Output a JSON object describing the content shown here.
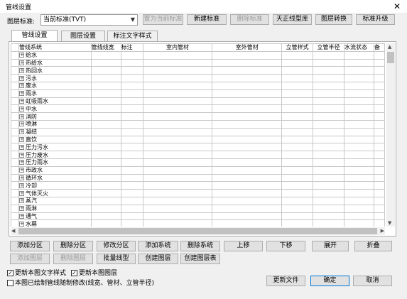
{
  "window": {
    "title": "管线设置",
    "close_glyph": "✕"
  },
  "standard": {
    "label": "图层标准:",
    "selected": "当前标准(TVT)"
  },
  "top_buttons": [
    "置为当前标准",
    "新建标准",
    "删除标准",
    "天正线型库",
    "图层转换",
    "标准升级"
  ],
  "tabs": [
    "管线设置",
    "图层设置",
    "标注文字样式"
  ],
  "columns": [
    "管线系统",
    "管线线宽",
    "标注",
    "室内管材",
    "室外管材",
    "立管样式",
    "立管半径",
    "水流状态",
    "备"
  ],
  "systems": [
    "给水",
    "热给水",
    "热回水",
    "污水",
    "废水",
    "雨水",
    "虹吸雨水",
    "中水",
    "消防",
    "喷淋",
    "凝结",
    "直饮",
    "压力污水",
    "压力废水",
    "压力雨水",
    "市政水",
    "循环水",
    "冷却",
    "气体灭火",
    "蒸汽",
    "雨淋",
    "通气",
    "水幕"
  ],
  "action_row1": [
    "添加分区",
    "删除分区",
    "修改分区",
    "添加系统",
    "删除系统",
    "上移",
    "下移",
    "展开",
    "折叠"
  ],
  "action_row2": [
    "添加图层",
    "删除图层",
    "批量线型",
    "创建图层",
    "创建图层表"
  ],
  "checkboxes": [
    {
      "label": "更新本图文字样式",
      "checked": true
    },
    {
      "label": "更新本图图层",
      "checked": true
    },
    {
      "label": "本图已绘制管线随制修改(线宽、管材、立管半径)",
      "checked": false
    }
  ],
  "bottom_buttons": [
    "更新文件",
    "确定",
    "取消"
  ],
  "icons": {
    "expand": "+",
    "scroll_up": "▲",
    "scroll_down": "▼",
    "scroll_left": "◀",
    "scroll_right": "▶",
    "dropdown": "▼"
  }
}
